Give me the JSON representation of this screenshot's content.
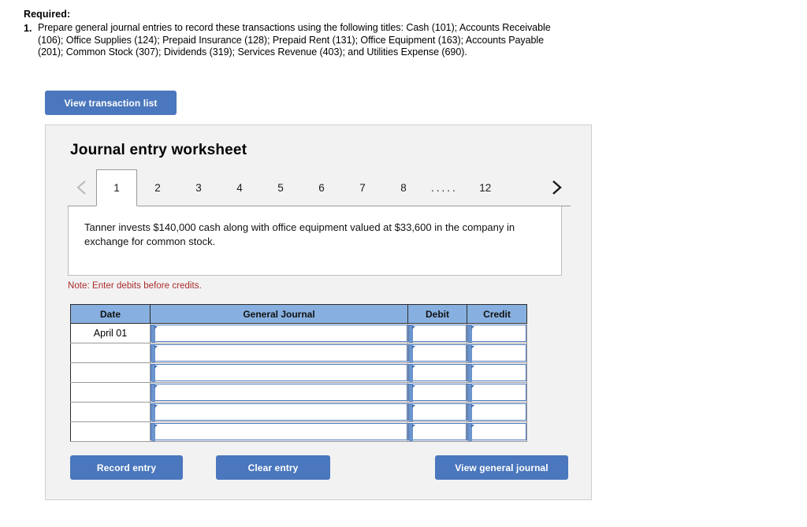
{
  "required": {
    "heading": "Required:",
    "item_number": "1.",
    "item_text": "Prepare general journal entries to record these transactions using the following titles: Cash (101); Accounts Receivable (106); Office Supplies (124); Prepaid Insurance (128); Prepaid Rent (131); Office Equipment (163); Accounts Payable (201); Common Stock (307); Dividends (319); Services Revenue (403); and Utilities Expense (690)."
  },
  "buttons": {
    "view_transaction_list": "View transaction list",
    "record_entry": "Record entry",
    "clear_entry": "Clear entry",
    "view_general_journal": "View general journal"
  },
  "worksheet": {
    "title": "Journal entry worksheet",
    "prev_icon": "chevron-left-icon",
    "next_icon": "chevron-right-icon",
    "tabs": [
      {
        "label": "1",
        "active": true
      },
      {
        "label": "2",
        "active": false
      },
      {
        "label": "3",
        "active": false
      },
      {
        "label": "4",
        "active": false
      },
      {
        "label": "5",
        "active": false
      },
      {
        "label": "6",
        "active": false
      },
      {
        "label": "7",
        "active": false
      },
      {
        "label": "8",
        "active": false
      },
      {
        "label": ".....",
        "active": false
      },
      {
        "label": "12",
        "active": false
      }
    ],
    "description": "Tanner invests $140,000 cash along with office equipment valued at $33,600 in the company in exchange for common stock.",
    "note": "Note: Enter debits before credits."
  },
  "journal_table": {
    "columns": [
      "Date",
      "General Journal",
      "Debit",
      "Credit"
    ],
    "rows": [
      {
        "date": "April 01",
        "general_journal": "",
        "debit": "",
        "credit": ""
      },
      {
        "date": "",
        "general_journal": "",
        "debit": "",
        "credit": ""
      },
      {
        "date": "",
        "general_journal": "",
        "debit": "",
        "credit": ""
      },
      {
        "date": "",
        "general_journal": "",
        "debit": "",
        "credit": ""
      },
      {
        "date": "",
        "general_journal": "",
        "debit": "",
        "credit": ""
      },
      {
        "date": "",
        "general_journal": "",
        "debit": "",
        "credit": ""
      }
    ]
  },
  "colors": {
    "button_blue": "#4a77bd",
    "table_header_blue": "#87b0e0",
    "note_red": "#ab2b2b",
    "panel_background": "#f2f2f2"
  }
}
